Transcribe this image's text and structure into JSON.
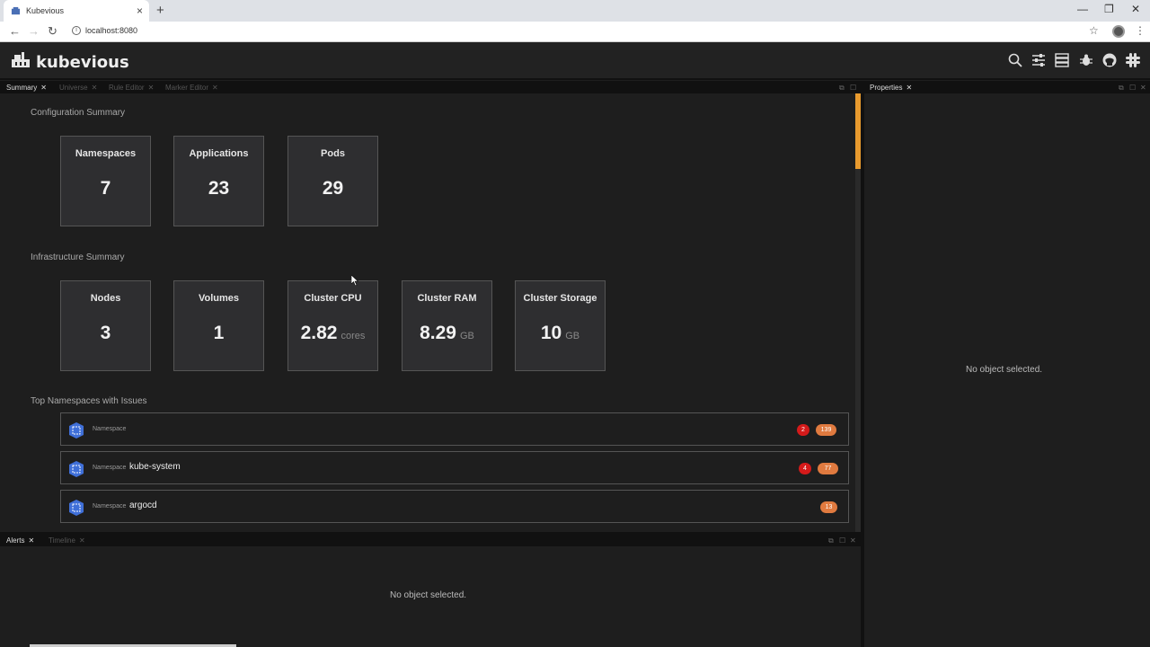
{
  "browser": {
    "tab_title": "Kubevious",
    "url": "localhost:8080"
  },
  "app": {
    "name": "kubevious",
    "header_icons": [
      "search-icon",
      "filter-icon",
      "server-icon",
      "bug-icon",
      "github-icon",
      "slack-icon"
    ]
  },
  "main_tabs": [
    {
      "label": "Summary",
      "active": true
    },
    {
      "label": "Universe",
      "active": false
    },
    {
      "label": "Rule Editor",
      "active": false
    },
    {
      "label": "Marker Editor",
      "active": false
    }
  ],
  "summary": {
    "config_title": "Configuration Summary",
    "config_cards": [
      {
        "label": "Namespaces",
        "value": "7",
        "unit": ""
      },
      {
        "label": "Applications",
        "value": "23",
        "unit": ""
      },
      {
        "label": "Pods",
        "value": "29",
        "unit": ""
      }
    ],
    "infra_title": "Infrastructure Summary",
    "infra_cards": [
      {
        "label": "Nodes",
        "value": "3",
        "unit": ""
      },
      {
        "label": "Volumes",
        "value": "1",
        "unit": ""
      },
      {
        "label": "Cluster CPU",
        "value": "2.82",
        "unit": "cores"
      },
      {
        "label": "Cluster RAM",
        "value": "8.29",
        "unit": "GB"
      },
      {
        "label": "Cluster Storage",
        "value": "10",
        "unit": "GB"
      }
    ],
    "issues_title": "Top Namespaces with Issues",
    "namespaces": [
      {
        "kind": "Namespace",
        "name": "",
        "errors": "2",
        "warnings": "139"
      },
      {
        "kind": "Namespace",
        "name": "kube-system",
        "errors": "4",
        "warnings": "77"
      },
      {
        "kind": "Namespace",
        "name": "argocd",
        "errors": "",
        "warnings": "13"
      }
    ]
  },
  "bottom_tabs": [
    {
      "label": "Alerts",
      "active": true
    },
    {
      "label": "Timeline",
      "active": false
    }
  ],
  "alerts": {
    "empty_text": "No object selected."
  },
  "properties": {
    "tab_label": "Properties",
    "empty_text": "No object selected."
  },
  "colors": {
    "error_badge": "#d51a1a",
    "warning_badge": "#e07a3f",
    "scroll_accent": "#e89a2e",
    "namespace_icon": "#3f6fd8"
  }
}
